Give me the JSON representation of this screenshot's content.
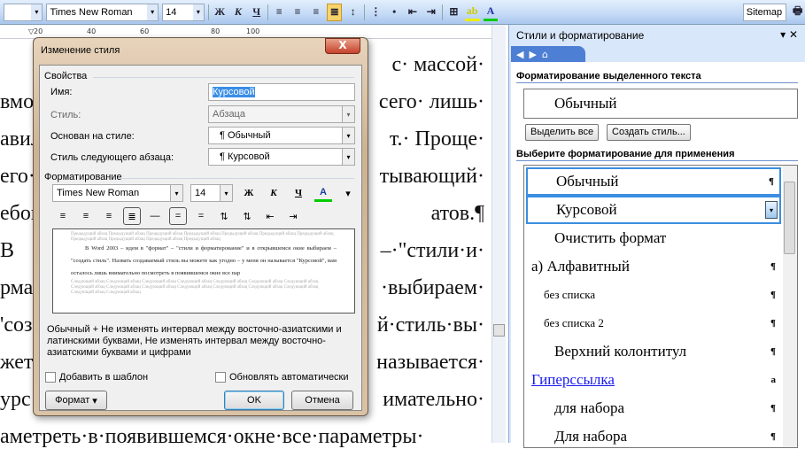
{
  "toolbar": {
    "font": "Times New Roman",
    "size": "14",
    "bold": "Ж",
    "italic": "К",
    "underline": "Ч",
    "sitemap": "Sitemap"
  },
  "ruler": [
    "20",
    "40",
    "60",
    "80",
    "100"
  ],
  "document": {
    "lines": [
      {
        "left": "",
        "right": "с· массой·"
      },
      {
        "left": "вмож",
        "right": "сего· лишь·"
      },
      {
        "left": "авил",
        "right": "т.· Проще·"
      },
      {
        "left": "его·",
        "right": "тывающий·"
      },
      {
        "left": "ебов",
        "right": "атов.¶"
      },
      {
        "left": "   В",
        "right": "–·\"стили·и·"
      },
      {
        "left": "рма",
        "right": "·выбираем·"
      },
      {
        "left": "'соз",
        "right": "й·стиль·вы·"
      },
      {
        "left": "жет",
        "right": "называется·"
      },
      {
        "left": "урс",
        "right": "имательно·"
      },
      {
        "left": "аметреть·в·появившемся·окне·все·параметры·",
        "right": ""
      }
    ]
  },
  "dialog": {
    "title": "Изменение стиля",
    "close": "X",
    "properties_group": "Свойства",
    "name_label": "Имя:",
    "name_value": "Курсовой",
    "style_label": "Стиль:",
    "style_value": "Абзаца",
    "based_label": "Основан на стиле:",
    "based_value": "¶ Обычный",
    "next_label": "Стиль следующего абзаца:",
    "next_value": "¶ Курсовой",
    "formatting_group": "Форматирование",
    "font": "Times New Roman",
    "size": "14",
    "bold": "Ж",
    "italic": "К",
    "underline": "Ч",
    "color": "A",
    "preview_prev": "Предыдущий абзац Предыдущий абзац Предыдущий абзац Предыдущий абзац Предыдущий абзац Предыдущий абзац Предыдущий абзац Предыдущий абзац Предыдущий абзац Предыдущий абзац Предыдущий абзац",
    "preview_text": "В Word 2003 – идем в \"формат\" – \"стили и форматирование\" и в открывшемся окне выбираем – \"создать стиль\". Назвать создаваемый стиль вы можете как угодно – у меня он называется \"Курсовой\", вам осталось лишь внимательно посмотреть в появившемся окне все пар",
    "preview_next": "Следующий абзац Следующий абзац Следующий абзац Следующий абзац Следующий абзац Следующий абзац Следующий абзац Следующий абзац Следующий абзац Следующий абзац Следующий абзац Следующий абзац Следующий абзац Следующий абзац Следующий абзац Следующий абзац",
    "description": "Обычный + Не изменять интервал между восточно-азиатскими и латинскими буквами, Не изменять интервал между восточно-азиатскими буквами и цифрами",
    "add_template": "Добавить в шаблон",
    "auto_update": "Обновлять автоматически",
    "format_button": "Формат",
    "ok": "OK",
    "cancel": "Отмена"
  },
  "pane": {
    "title": "Стили и форматирование",
    "selected_header": "Форматирование выделенного текста",
    "selected_style": "Обычный",
    "select_all": "Выделить все",
    "new_style": "Создать стиль...",
    "apply_header": "Выберите форматирование для применения",
    "styles": [
      {
        "label": "Обычный",
        "mark": "¶"
      },
      {
        "label": "Курсовой",
        "mark": ""
      },
      {
        "label": "Очистить формат",
        "mark": ""
      },
      {
        "label": "а)  Алфавитный",
        "mark": "¶"
      },
      {
        "label": "без списка",
        "mark": "¶"
      },
      {
        "label": "без списка 2",
        "mark": "¶"
      },
      {
        "label": "Верхний колонтитул",
        "mark": "¶"
      },
      {
        "label": "Гиперссылка",
        "mark": "a"
      },
      {
        "label": "для набора",
        "mark": "¶"
      },
      {
        "label": "Для набора",
        "mark": "¶"
      }
    ]
  },
  "colors": {
    "accent": "#3b8ee0",
    "highlight": "#f8d36a",
    "link": "#1a1aee",
    "font_color": "#00b050"
  }
}
